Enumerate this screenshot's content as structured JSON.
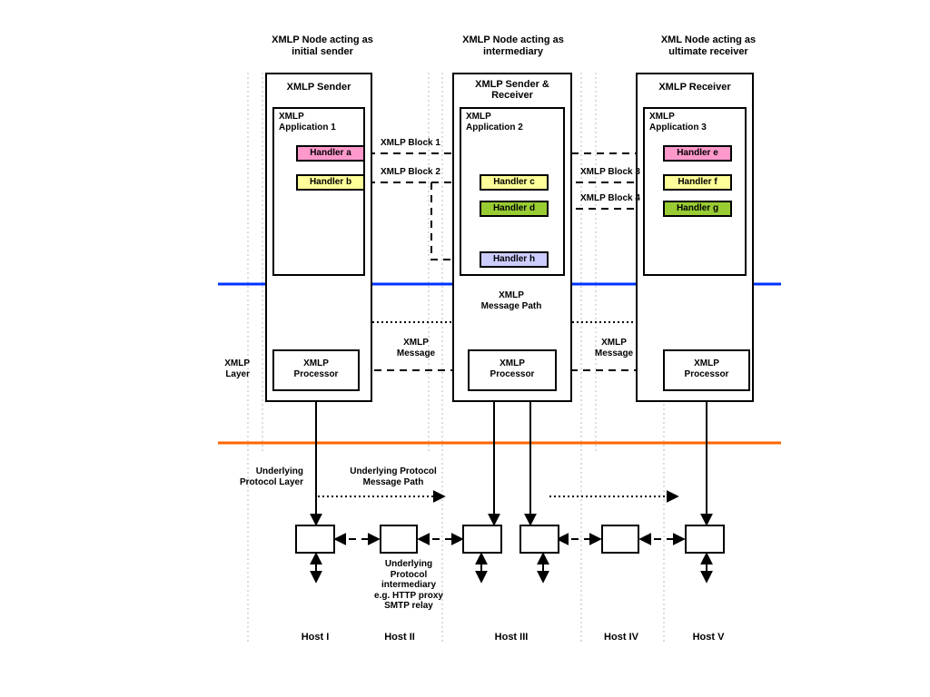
{
  "roles": {
    "sender": "XMLP Node acting as\ninitial sender",
    "inter": "XMLP Node acting as\nintermediary",
    "receiver": "XML Node acting as\nultimate receiver"
  },
  "nodes": {
    "sender_title": "XMLP Sender",
    "inter_title": "XMLP Sender &\nReceiver",
    "receiver_title": "XMLP Receiver"
  },
  "apps": {
    "app1": "XMLP\nApplication 1",
    "app2": "XMLP\nApplication 2",
    "app3": "XMLP\nApplication 3"
  },
  "handlers": {
    "a": "Handler a",
    "b": "Handler b",
    "c": "Handler c",
    "d": "Handler d",
    "e": "Handler e",
    "f": "Handler f",
    "g": "Handler g",
    "h": "Handler h"
  },
  "blocks": {
    "b1": "XMLP Block 1",
    "b2": "XMLP Block 2",
    "b3": "XMLP Block 3",
    "b4": "XMLP Block 4"
  },
  "layers": {
    "xmlp": "XMLP\nLayer",
    "under": "Underlying\nProtocol Layer"
  },
  "proc": "XMLP\nProcessor",
  "msgpath": "XMLP\nMessage Path",
  "msg": "XMLP\nMessage",
  "under_msgpath": "Underlying Protocol\nMessage Path",
  "under_inter": "Underlying\nProtocol\nintermediary\ne.g. HTTP proxy\nSMTP relay",
  "hosts": {
    "h1": "Host I",
    "h2": "Host II",
    "h3": "Host III",
    "h4": "Host IV",
    "h5": "Host V"
  }
}
